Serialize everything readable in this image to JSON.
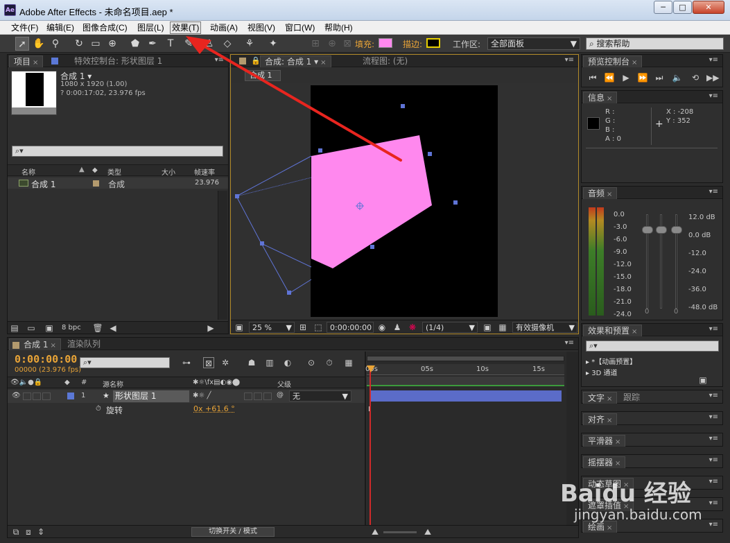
{
  "window": {
    "app_icon": "Ae",
    "title": "Adobe After Effects - 未命名项目.aep *",
    "min_label": "─",
    "max_label": "□",
    "close_label": "✕"
  },
  "menu": [
    "文件(F)",
    "编辑(E)",
    "图像合成(C)",
    "图层(L)",
    "效果(T)",
    "动画(A)",
    "视图(V)",
    "窗口(W)",
    "帮助(H)"
  ],
  "toolbar": {
    "fill_label": "填充:",
    "fill_color": "#ff88ee",
    "stroke_label": "描边:",
    "stroke_color": "#e8d000",
    "workspace_label": "工作区:",
    "workspace_value": "全部面板",
    "search_help": "搜索帮助"
  },
  "project_panel": {
    "tab": "项目",
    "effect_tab": "特效控制台: 形状图层 1",
    "comp_name": "合成 1 ▾",
    "comp_size": "1080 x 1920 (1.00)",
    "comp_duration": "? 0:00:17:02, 23.976 fps",
    "search_placeholder": "⌕▾",
    "col_name": "名称",
    "col_type": "类型",
    "col_size": "大小",
    "col_fps": "帧速率",
    "row_name": "合成 1",
    "row_type": "合成",
    "row_fps": "23.976",
    "bpc": "8 bpc"
  },
  "comp_panel": {
    "tab": "合成: 合成 1",
    "flow_tab": "流程图: (无)",
    "breadcrumb": "合成 1",
    "zoom": "25 %",
    "timecode": "0:00:00:00",
    "resolution": "(1/4)",
    "camera": "有效摄像机"
  },
  "preview": {
    "tab": "预览控制台"
  },
  "info": {
    "tab": "信息",
    "r": "R :",
    "g": "G :",
    "b": "B :",
    "a": "A : 0",
    "x": "X : -208",
    "y": "Y : 352"
  },
  "audio": {
    "tab": "音频",
    "left_labels": [
      "0.0",
      "-3.0",
      "-6.0",
      "-9.0",
      "-12.0",
      "-15.0",
      "-18.0",
      "-21.0",
      "-24.0"
    ],
    "right_labels": [
      "12.0 dB",
      "0.0 dB",
      "-12.0",
      "-24.0",
      "-36.0",
      "-48.0 dB"
    ],
    "zero_left": "0",
    "zero_right": "0"
  },
  "effects_presets": {
    "tab": "效果和预置",
    "item1": "*【动画预置】",
    "item2": "3D 通道"
  },
  "side_tabs": {
    "text": "文字",
    "paragraph": "跟踪",
    "align": "对齐",
    "smoother": "平滑器",
    "wiggler": "摇摆器",
    "motion": "动态草图",
    "mask": "遮罩插值",
    "paint": "绘画"
  },
  "timeline": {
    "tab": "合成 1",
    "render_tab": "渲染队列",
    "timecode": "0:00:00:00",
    "frame_info": "00000 (23.976 fps)",
    "col_source": "源名称",
    "col_parent": "父级",
    "layer_num": "1",
    "layer_name": "形状图层 1",
    "parent_value": "无",
    "prop_name": "旋转",
    "prop_value": "0x +61.6 °",
    "ruler": [
      "00s",
      "05s",
      "10s",
      "15s"
    ],
    "toggle_label": "切换开关 / 模式"
  },
  "watermark": {
    "brand": "Baidu 经验",
    "url": "jingyan.baidu.com"
  }
}
